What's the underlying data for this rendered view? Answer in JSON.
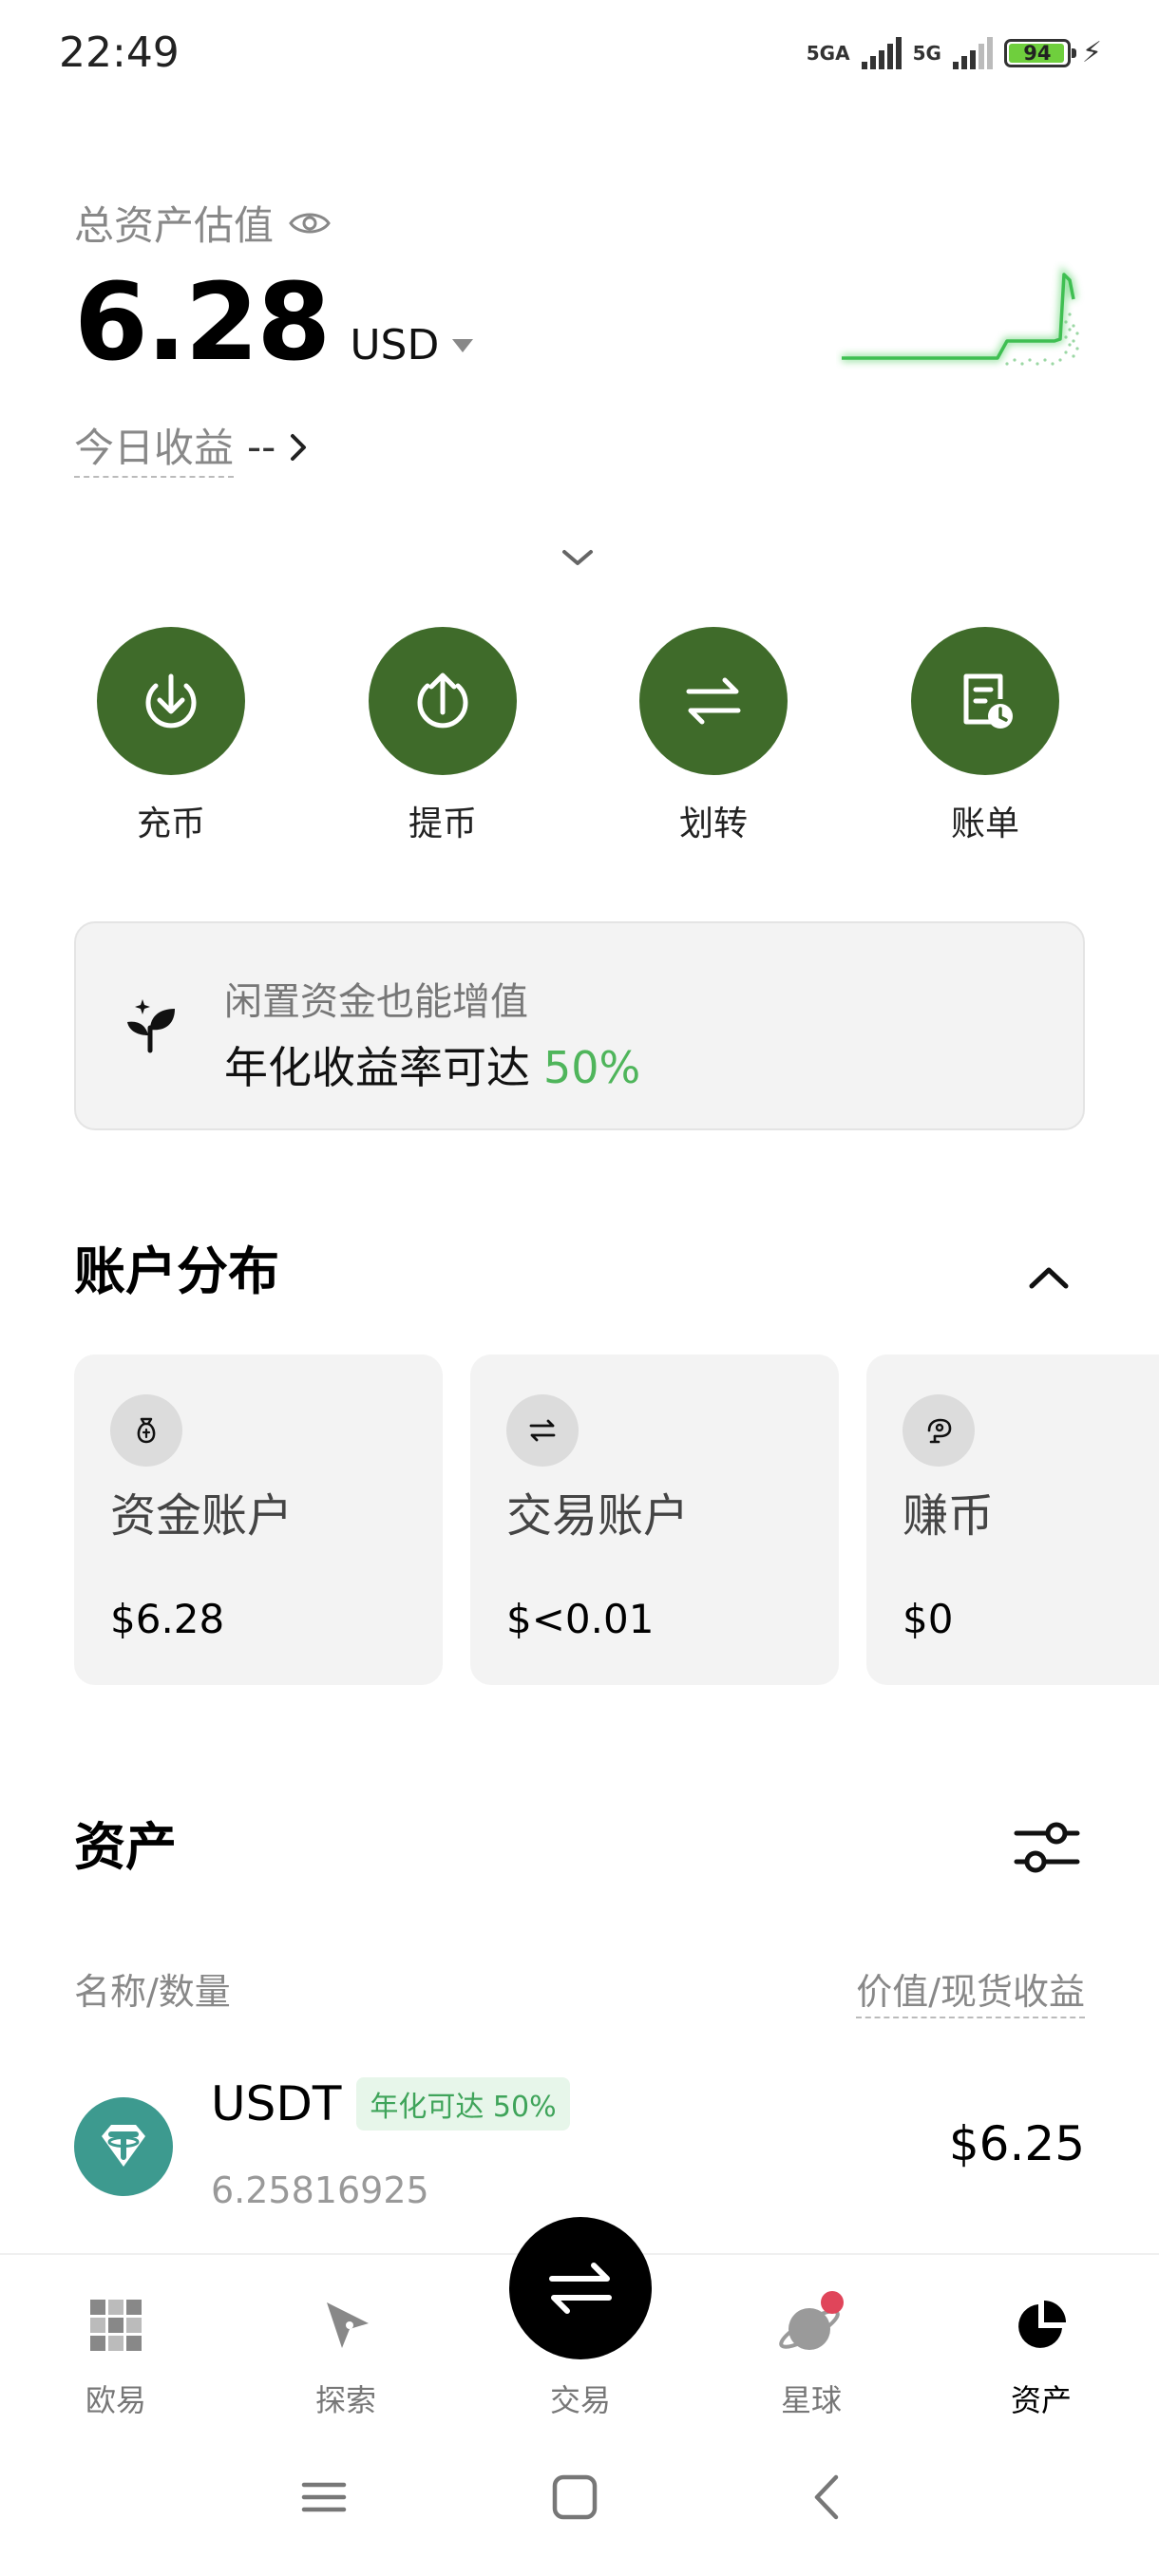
{
  "status_bar": {
    "time": "22:49",
    "net1": "5GA",
    "net2": "5G",
    "battery": "94"
  },
  "header": {
    "label": "总资产估值",
    "amount": "6.28",
    "currency": "USD",
    "today_label": "今日收益",
    "today_value": "--"
  },
  "actions": [
    {
      "label": "充币",
      "icon": "deposit-icon"
    },
    {
      "label": "提币",
      "icon": "withdraw-icon"
    },
    {
      "label": "划转",
      "icon": "transfer-icon"
    },
    {
      "label": "账单",
      "icon": "bill-icon"
    }
  ],
  "promo": {
    "line1": "闲置资金也能增值",
    "line2": "年化收益率可达",
    "rate": "50%"
  },
  "accounts": {
    "title": "账户分布",
    "items": [
      {
        "name": "资金账户",
        "value": "$6.28",
        "icon": "money-bag-icon"
      },
      {
        "name": "交易账户",
        "value": "$<0.01",
        "icon": "swap-icon"
      },
      {
        "name": "赚币",
        "value": "$0",
        "icon": "earn-icon"
      }
    ]
  },
  "assets": {
    "title": "资产",
    "col_left": "名称/数量",
    "col_right": "价值/现货收益",
    "rows": [
      {
        "symbol": "USDT",
        "tag": "年化可达 50%",
        "qty": "6.25816925",
        "value": "$6.25"
      }
    ]
  },
  "nav": {
    "items": [
      {
        "label": "欧易",
        "icon": "okx-logo-icon"
      },
      {
        "label": "探索",
        "icon": "compass-icon"
      },
      {
        "label": "交易",
        "icon": "trade-swap-icon"
      },
      {
        "label": "星球",
        "icon": "planet-icon"
      },
      {
        "label": "资产",
        "icon": "pie-chart-icon"
      }
    ],
    "active": "资产"
  },
  "colors": {
    "brand_green": "#3f6b2a",
    "accent_green": "#4fb55b",
    "usdt": "#3d9a8f"
  }
}
